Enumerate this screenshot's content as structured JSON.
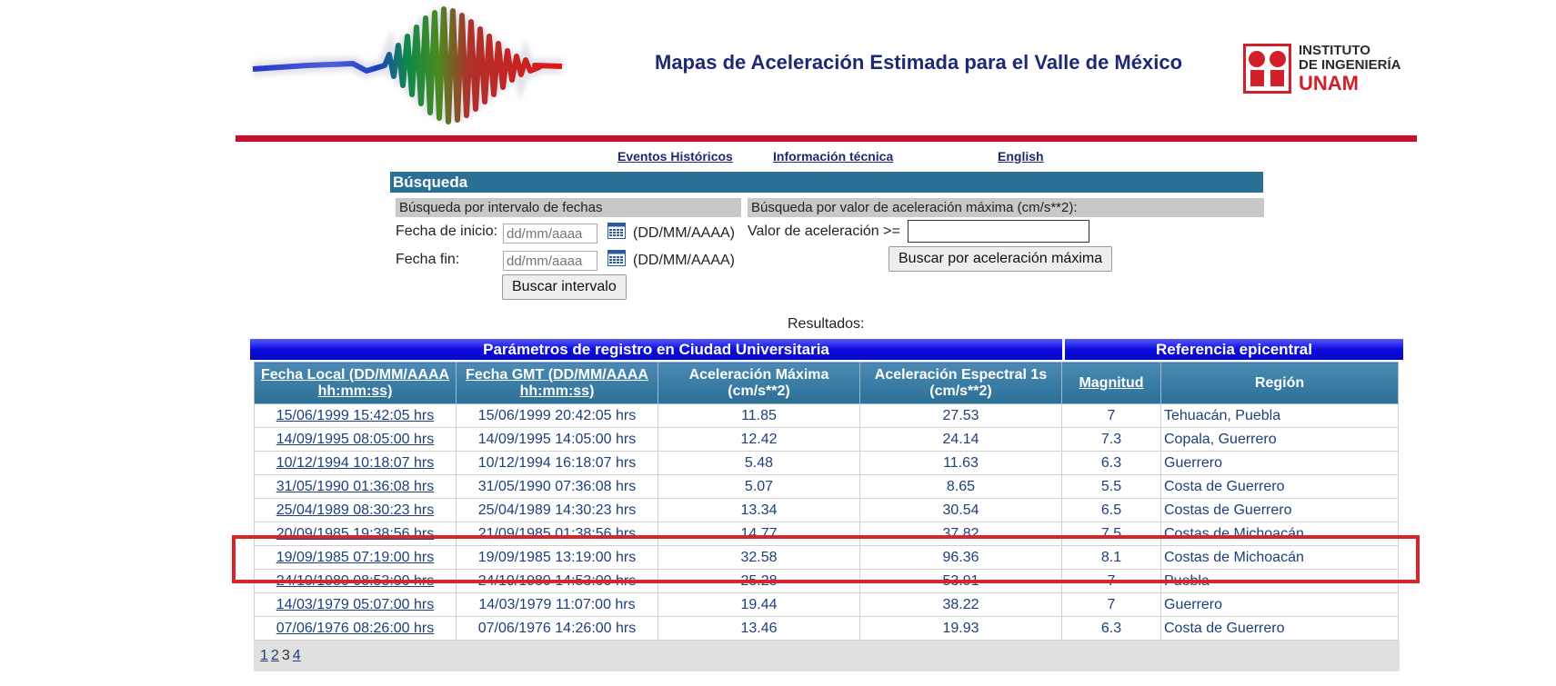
{
  "header": {
    "title": "Mapas de Aceleración Estimada para el Valle de México",
    "institute_line1": "INSTITUTO",
    "institute_line2": "DE INGENIERÍA",
    "institute_line3": "UNAM"
  },
  "nav": [
    {
      "label": "Eventos Históricos"
    },
    {
      "label": "Información técnica"
    },
    {
      "label": "English"
    }
  ],
  "search": {
    "title": "Búsqueda",
    "date_section": "Búsqueda por intervalo de fechas",
    "accel_section": "Búsqueda por valor de aceleración máxima (cm/s**2):",
    "start_label": "Fecha de inicio:",
    "end_label": "Fecha fin:",
    "date_placeholder": "dd/mm/aaaa",
    "date_format": "(DD/MM/AAAA)",
    "accel_label": "Valor de aceleración >=",
    "accel_value": "",
    "interval_button": "Buscar intervalo",
    "accel_button": "Buscar por aceleración máxima"
  },
  "results": {
    "label": "Resultados:",
    "group_cu": "Parámetros de registro en Ciudad Universitaria",
    "group_epi": "Referencia epicentral",
    "columns": {
      "local": "Fecha Local (DD/MM/AAAA hh:mm:ss)",
      "gmt": "Fecha GMT (DD/MM/AAAA hh:mm:ss)",
      "accel_max": "Aceleración Máxima (cm/s**2)",
      "accel_spec": "Aceleración Espectral 1s (cm/s**2)",
      "magnitude": "Magnitud",
      "region": "Región"
    },
    "rows": [
      {
        "local": "15/06/1999 15:42:05 hrs",
        "gmt": "15/06/1999 20:42:05 hrs",
        "accel_max": "11.85",
        "accel_spec": "27.53",
        "magnitude": "7",
        "region": "Tehuacán, Puebla"
      },
      {
        "local": "14/09/1995 08:05:00 hrs",
        "gmt": "14/09/1995 14:05:00 hrs",
        "accel_max": "12.42",
        "accel_spec": "24.14",
        "magnitude": "7.3",
        "region": "Copala, Guerrero"
      },
      {
        "local": "10/12/1994 10:18:07 hrs",
        "gmt": "10/12/1994 16:18:07 hrs",
        "accel_max": "5.48",
        "accel_spec": "11.63",
        "magnitude": "6.3",
        "region": "Guerrero"
      },
      {
        "local": "31/05/1990 01:36:08 hrs",
        "gmt": "31/05/1990 07:36:08 hrs",
        "accel_max": "5.07",
        "accel_spec": "8.65",
        "magnitude": "5.5",
        "region": "Costa de Guerrero"
      },
      {
        "local": "25/04/1989 08:30:23 hrs",
        "gmt": "25/04/1989 14:30:23 hrs",
        "accel_max": "13.34",
        "accel_spec": "30.54",
        "magnitude": "6.5",
        "region": "Costas de Guerrero"
      },
      {
        "local": "20/09/1985 19:38:56 hrs",
        "gmt": "21/09/1985 01:38:56 hrs",
        "accel_max": "14.77",
        "accel_spec": "37.82",
        "magnitude": "7.5",
        "region": "Costas de Michoacán"
      },
      {
        "local": "19/09/1985 07:19:00 hrs",
        "gmt": "19/09/1985 13:19:00 hrs",
        "accel_max": "32.58",
        "accel_spec": "96.36",
        "magnitude": "8.1",
        "region": "Costas de Michoacán"
      },
      {
        "local": "24/10/1980 08:53:00 hrs",
        "gmt": "24/10/1980 14:53:00 hrs",
        "accel_max": "25.28",
        "accel_spec": "53.91",
        "magnitude": "7",
        "region": "Puebla"
      },
      {
        "local": "14/03/1979 05:07:00 hrs",
        "gmt": "14/03/1979 11:07:00 hrs",
        "accel_max": "19.44",
        "accel_spec": "38.22",
        "magnitude": "7",
        "region": "Guerrero"
      },
      {
        "local": "07/06/1976 08:26:00 hrs",
        "gmt": "07/06/1976 14:26:00 hrs",
        "accel_max": "13.46",
        "accel_spec": "19.93",
        "magnitude": "6.3",
        "region": "Costa de Guerrero"
      }
    ],
    "pages": [
      {
        "label": "1",
        "current": false
      },
      {
        "label": "2",
        "current": false
      },
      {
        "label": "3",
        "current": true
      },
      {
        "label": "4",
        "current": false
      }
    ]
  },
  "colors": {
    "brand_red": "#c8102e",
    "title_navy": "#1d2a73",
    "panel_blue": "#2c6f95",
    "highlight": "#d7262b"
  }
}
